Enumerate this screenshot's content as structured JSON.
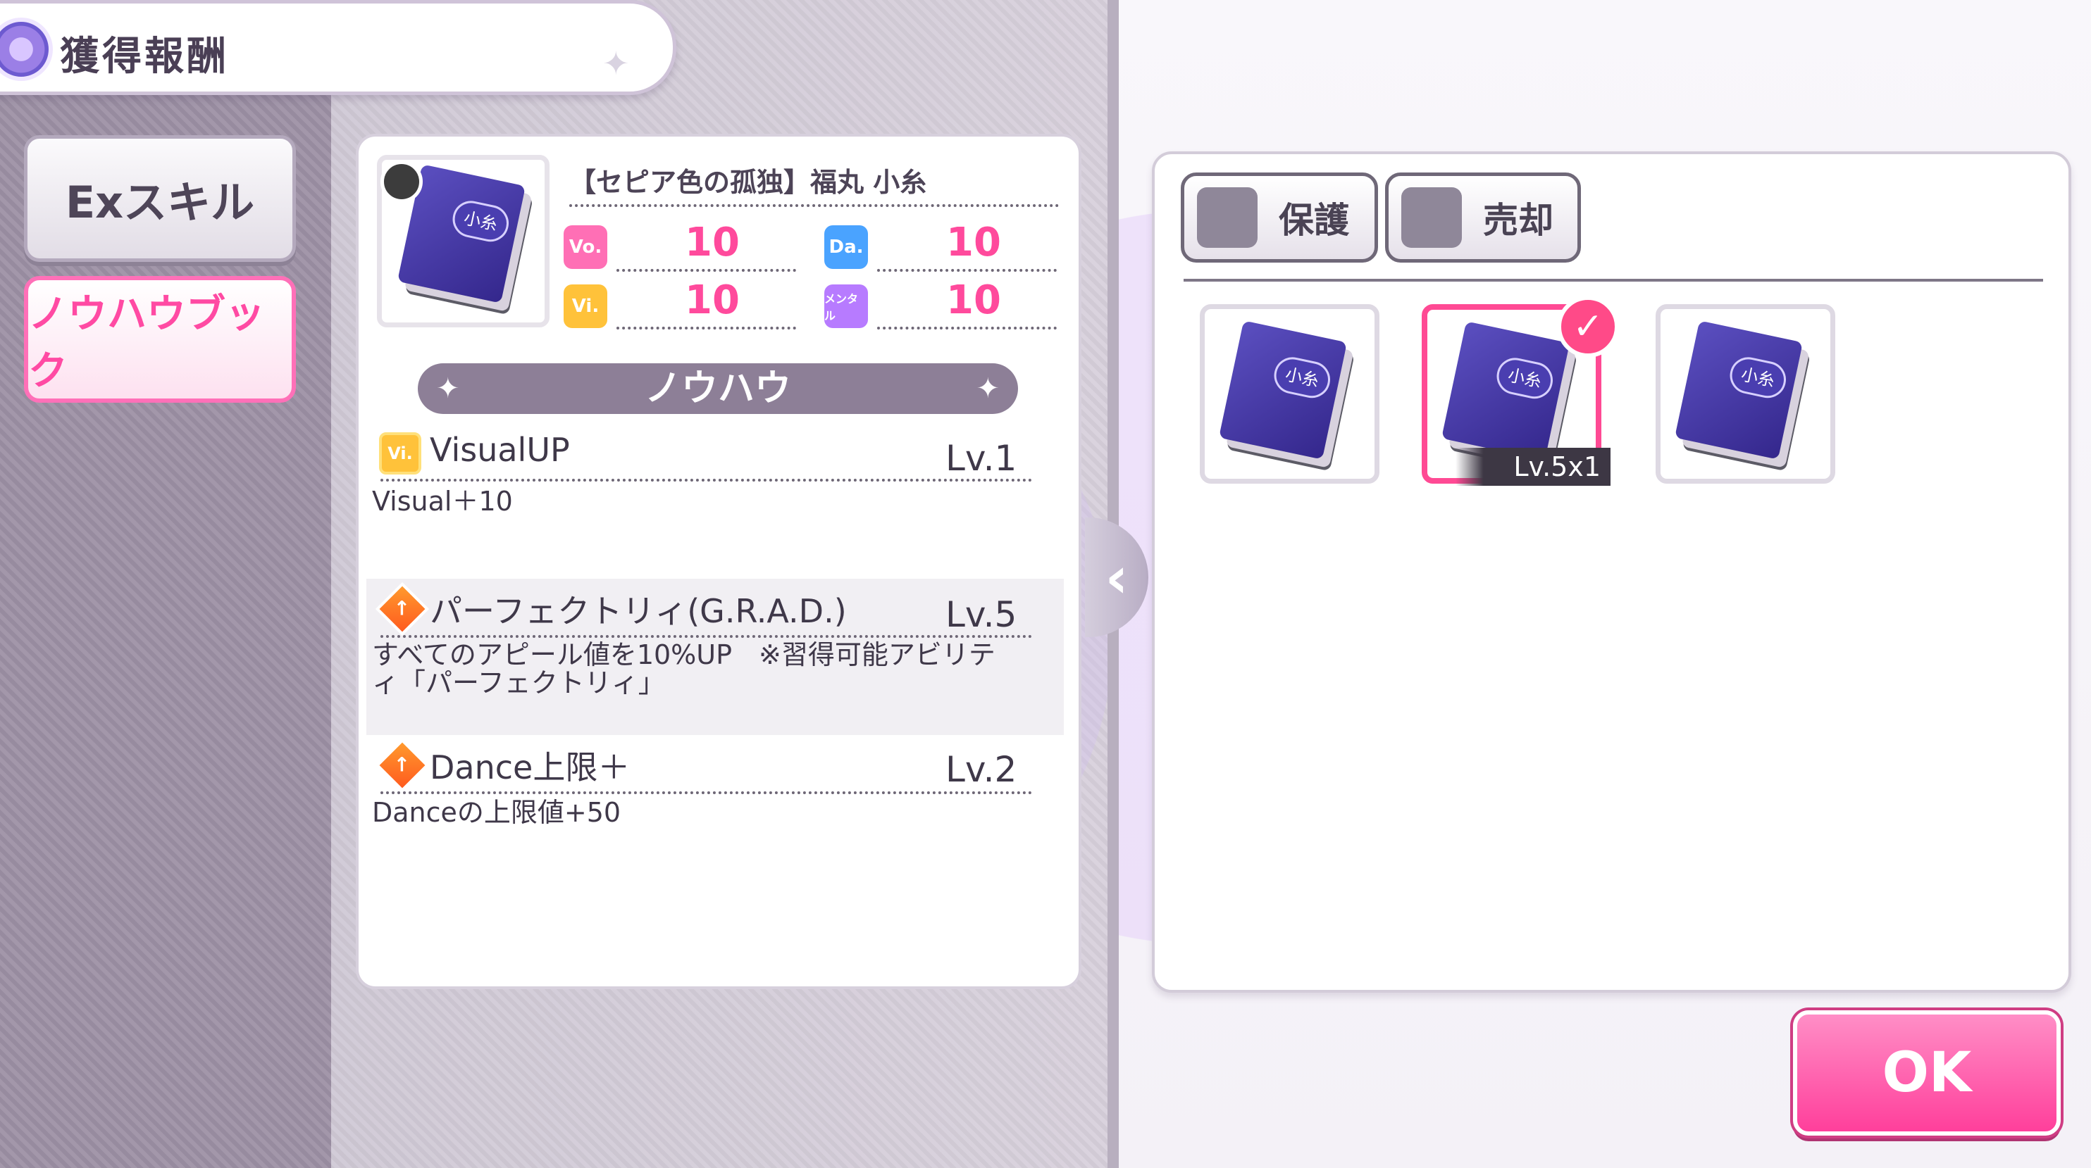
{
  "header": {
    "title": "獲得報酬"
  },
  "tabs": [
    {
      "label": "Exスキル"
    },
    {
      "label": "ノウハウブック"
    }
  ],
  "item": {
    "name": "【セピア色の孤独】福丸 小糸",
    "book_label": "小糸",
    "stats": [
      {
        "icon": "Vo.",
        "value": "10"
      },
      {
        "icon": "Da.",
        "value": "10"
      },
      {
        "icon": "Vi.",
        "value": "10"
      },
      {
        "icon": "メンタル",
        "value": "10"
      }
    ]
  },
  "section": {
    "title": "ノウハウ"
  },
  "skills": [
    {
      "icon": "Vi.",
      "name": "VisualUP",
      "level": "Lv.1",
      "desc": "Visual＋10"
    },
    {
      "icon": "↑",
      "name": "パーフェクトリィ(G.R.A.D.)",
      "level": "Lv.5",
      "desc": "すべてのアピール値を10%UP　※習得可能アビリティ「パーフェクトリィ」"
    },
    {
      "icon": "↑",
      "name": "Dance上限＋",
      "level": "Lv.2",
      "desc": "Danceの上限値+50"
    }
  ],
  "filters": [
    {
      "label": "保護"
    },
    {
      "label": "売却"
    }
  ],
  "selected_tag": "Lv.5x1",
  "ok_label": "OK",
  "colors": {
    "accent_pink": "#ff4a94",
    "panel": "#ffffff",
    "sidebar": "#9d91a5"
  }
}
